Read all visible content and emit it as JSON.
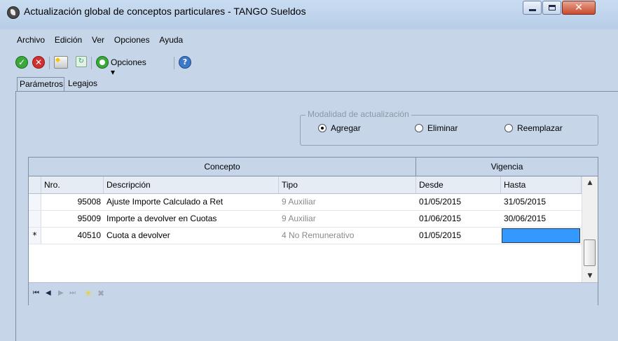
{
  "window": {
    "title": "Actualización global de conceptos particulares - TANGO Sueldos",
    "app_icon": "tango-app-icon",
    "controls": {
      "minimize": "minimize-icon",
      "maximize": "maximize-icon",
      "close": "✕"
    }
  },
  "menu": [
    "Archivo",
    "Edición",
    "Ver",
    "Opciones",
    "Ayuda"
  ],
  "toolbar": {
    "accept_glyph": "✓",
    "cancel_glyph": "✕",
    "refresh_glyph": "↻",
    "help_glyph": "?",
    "opciones_label": "Opciones ▾"
  },
  "tabs": [
    "Parámetros",
    "Legajos"
  ],
  "modalidad": {
    "title": "Modalidad de actualización",
    "options": [
      "Agregar",
      "Eliminar",
      "Reemplazar"
    ],
    "selected": "Agregar"
  },
  "grid": {
    "band_headers": [
      "Concepto",
      "Vigencia"
    ],
    "columns": [
      "Nro.",
      "Descripción",
      "Tipo",
      "Desde",
      "Hasta"
    ],
    "rows": [
      {
        "selector": "",
        "nro": "95008",
        "descripcion": "Ajuste Importe Calculado a Ret",
        "tipo": "9 Auxiliar",
        "desde": "01/05/2015",
        "hasta": "31/05/2015"
      },
      {
        "selector": "",
        "nro": "95009",
        "descripcion": "Importe a devolver en Cuotas",
        "tipo": "9 Auxiliar",
        "desde": "01/06/2015",
        "hasta": "30/06/2015"
      },
      {
        "selector": "*",
        "nro": "40510",
        "descripcion": "Cuota a devolver",
        "tipo": "4 No Remunerativo",
        "desde": "01/05/2015",
        "hasta": ""
      }
    ],
    "scroll": {
      "up": "▲",
      "down": "▼"
    },
    "navigator": {
      "first": "⏮",
      "prev": "◀",
      "next": "▶",
      "last": "⏭",
      "new": "✳",
      "delete": "✖"
    }
  },
  "colors": {
    "window_bg": "#c6d5e8",
    "selected_cell": "#3399ff",
    "gray_text": "#8a8a8a",
    "ok_green": "#3aa83a",
    "cancel_red": "#d22f2f"
  }
}
